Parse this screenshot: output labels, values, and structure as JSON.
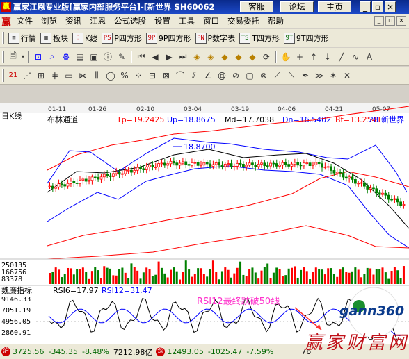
{
  "titlebar": {
    "icon": "赢",
    "title": "赢家江恩专业版[赢家内部服务平台]-[新世界  SH60062",
    "buttons": [
      "客服",
      "论坛",
      "主页"
    ],
    "button_icons": [
      "min-icon",
      "restore-icon",
      "close-icon"
    ]
  },
  "menubar": {
    "logo": "赢",
    "items": [
      "文件",
      "浏览",
      "资讯",
      "江恩",
      "公式选股",
      "设置",
      "工具",
      "窗口",
      "交易委托",
      "帮助"
    ],
    "mdi_icons": [
      "min-icon",
      "restore-icon",
      "close-icon"
    ]
  },
  "toolbar1": {
    "buttons": [
      {
        "icon": "list-icon",
        "label": "行情"
      },
      {
        "icon": "grid-icon",
        "label": "板块"
      },
      {
        "icon": "candle-icon",
        "label": "K线"
      },
      {
        "icon": "PS",
        "label": "P四方形"
      },
      {
        "icon": "9P",
        "label": "9P四方形"
      },
      {
        "icon": "PN",
        "label": "P数字表"
      },
      {
        "icon": "TS",
        "label": "T四方形"
      },
      {
        "icon": "9T",
        "label": "9T四方形"
      }
    ]
  },
  "chart": {
    "indicator_name": "布林通道",
    "params": [
      {
        "label": "Tp=19.2425",
        "color": "#ff0000"
      },
      {
        "label": "Up=18.8675",
        "color": "#0000ff"
      },
      {
        "label": "Md=17.7038",
        "color": "#000000"
      },
      {
        "label": "Dn=16.5402",
        "color": "#0000ff"
      },
      {
        "label": "Bt=13.2541",
        "color": "#ff0000"
      }
    ],
    "period_label": "日K线",
    "stock_tag": "28",
    "stock_name": "新世界",
    "peak_label": "18.8700",
    "date_ticks": [
      "01-11",
      "01-26",
      "02-10",
      "03-04",
      "03-19",
      "04-06",
      "04-21",
      "05-07"
    ],
    "volume_ticks": [
      "250135",
      "166756",
      "83378"
    ],
    "rsi": {
      "name": "魏廉指标",
      "rsi6": "RSI6=17.97",
      "rsi12": "RSI12=31.47",
      "annotation": "RSI12最终跌破50线",
      "ticks": [
        "9146.33",
        "7051.19",
        "4956.05",
        "2860.91"
      ]
    }
  },
  "statusbar": {
    "sh_mark": "沪",
    "sh_index": "3725.56",
    "sh_change": "-345.35",
    "sh_pct": "-8.48%",
    "sh_amount": "7212.98亿",
    "sz_mark": "深",
    "sz_index": "12493.05",
    "sz_change": "-1025.47",
    "sz_pct": "-7.59%",
    "tail": "76"
  },
  "watermark": {
    "site": "gann360",
    "text": "赢家财富网"
  },
  "colors": {
    "up": "#ff0000",
    "down": "#008000",
    "upper_band": "#0000ff",
    "mid_band": "#000000",
    "outer_band": "#ff0000"
  }
}
